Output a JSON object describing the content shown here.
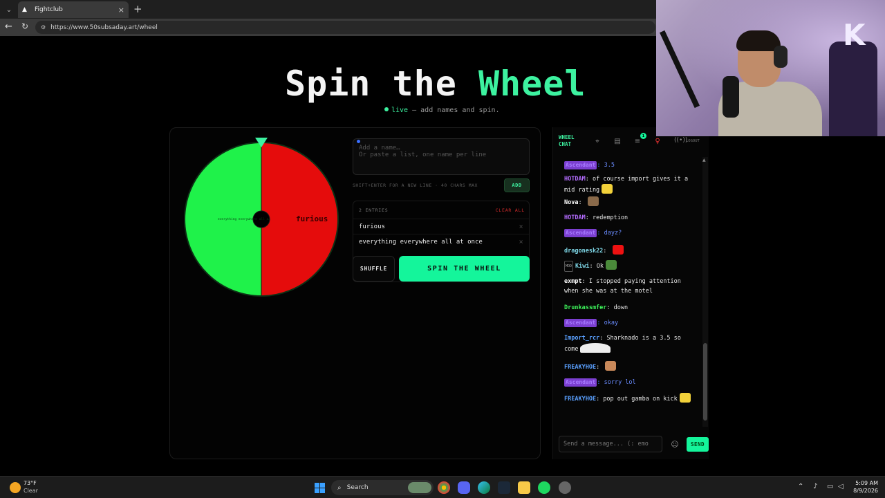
{
  "browser": {
    "tab_title": "Fightclub",
    "url": "https://www.50subsaday.art/wheel",
    "new_tab_glyph": "+",
    "close_glyph": "×"
  },
  "page": {
    "title_part1": "Spin the ",
    "title_accent": "Wheel",
    "subtitle_live": "live",
    "subtitle_rest": " — add names and spin.",
    "accent_color": "#3df2a0"
  },
  "wheel": {
    "segments": [
      {
        "label": "everything everywhere all a…",
        "color": "#1ff24a"
      },
      {
        "label": "furious",
        "color": "#e50c0c"
      }
    ]
  },
  "form": {
    "placeholder": "Add a name…\nOr paste a list, one name per line",
    "hint": "SHIFT+ENTER FOR A NEW LINE · 40 CHARS MAX",
    "add_label": "ADD"
  },
  "entries": {
    "count_label": "2 ENTRIES",
    "clear_label": "CLEAR ALL",
    "items": [
      "furious",
      "everything everywhere all at once"
    ],
    "remove_glyph": "×"
  },
  "actions": {
    "shuffle_label": "SHUFFLE",
    "spin_label": "SPIN THE WHEEL"
  },
  "chat": {
    "title": "WHEEL CHAT",
    "logout_label": "LOGOUT",
    "notification_count": "1",
    "input_placeholder": "Send a message... (: emo",
    "send_label": "SEND",
    "messages": [
      {
        "user": "Ascendant",
        "text": "3.5",
        "role_badge": true,
        "color": "#a77bff"
      },
      {
        "user": "HOTDAM",
        "text": "of course import gives it a mid rating",
        "color": "#b46cff"
      },
      {
        "user": "Nova",
        "text": "",
        "color": "#ffffff"
      },
      {
        "user": "HOTDAM",
        "text": "redemption",
        "color": "#b46cff"
      },
      {
        "user": "Ascendant",
        "text": "dayz?",
        "role_badge": true,
        "color": "#a77bff"
      },
      {
        "user": "dragonesk22",
        "text": "",
        "color": "#7fd8e8"
      },
      {
        "user": "Kiwi",
        "text": "Ok",
        "mod": "MOD",
        "color": "#7fd8e8"
      },
      {
        "user": "exmpt",
        "text": "I stopped paying attention when she was at the motel",
        "color": "#ffffff"
      },
      {
        "user": "Drunkassmfer",
        "text": "down",
        "color": "#3df25a"
      },
      {
        "user": "Ascendant",
        "text": "okay",
        "role_badge": true,
        "color": "#a77bff"
      },
      {
        "user": "Import_rcr",
        "text": "Sharknado is a 3.5 so come",
        "color": "#5aa0ff"
      },
      {
        "user": "FREAKYHOE",
        "text": "",
        "color": "#5aa0ff"
      },
      {
        "user": "Ascendant",
        "text": "sorry lol",
        "role_badge": true,
        "color": "#a77bff"
      },
      {
        "user": "FREAKYHOE",
        "text": "pop out gamba on kick",
        "color": "#5aa0ff"
      }
    ]
  },
  "taskbar": {
    "weather_temp": "73°F",
    "weather_cond": "Clear",
    "search_label": "Search",
    "time": "5:09 AM",
    "date": "8/9/2026"
  }
}
